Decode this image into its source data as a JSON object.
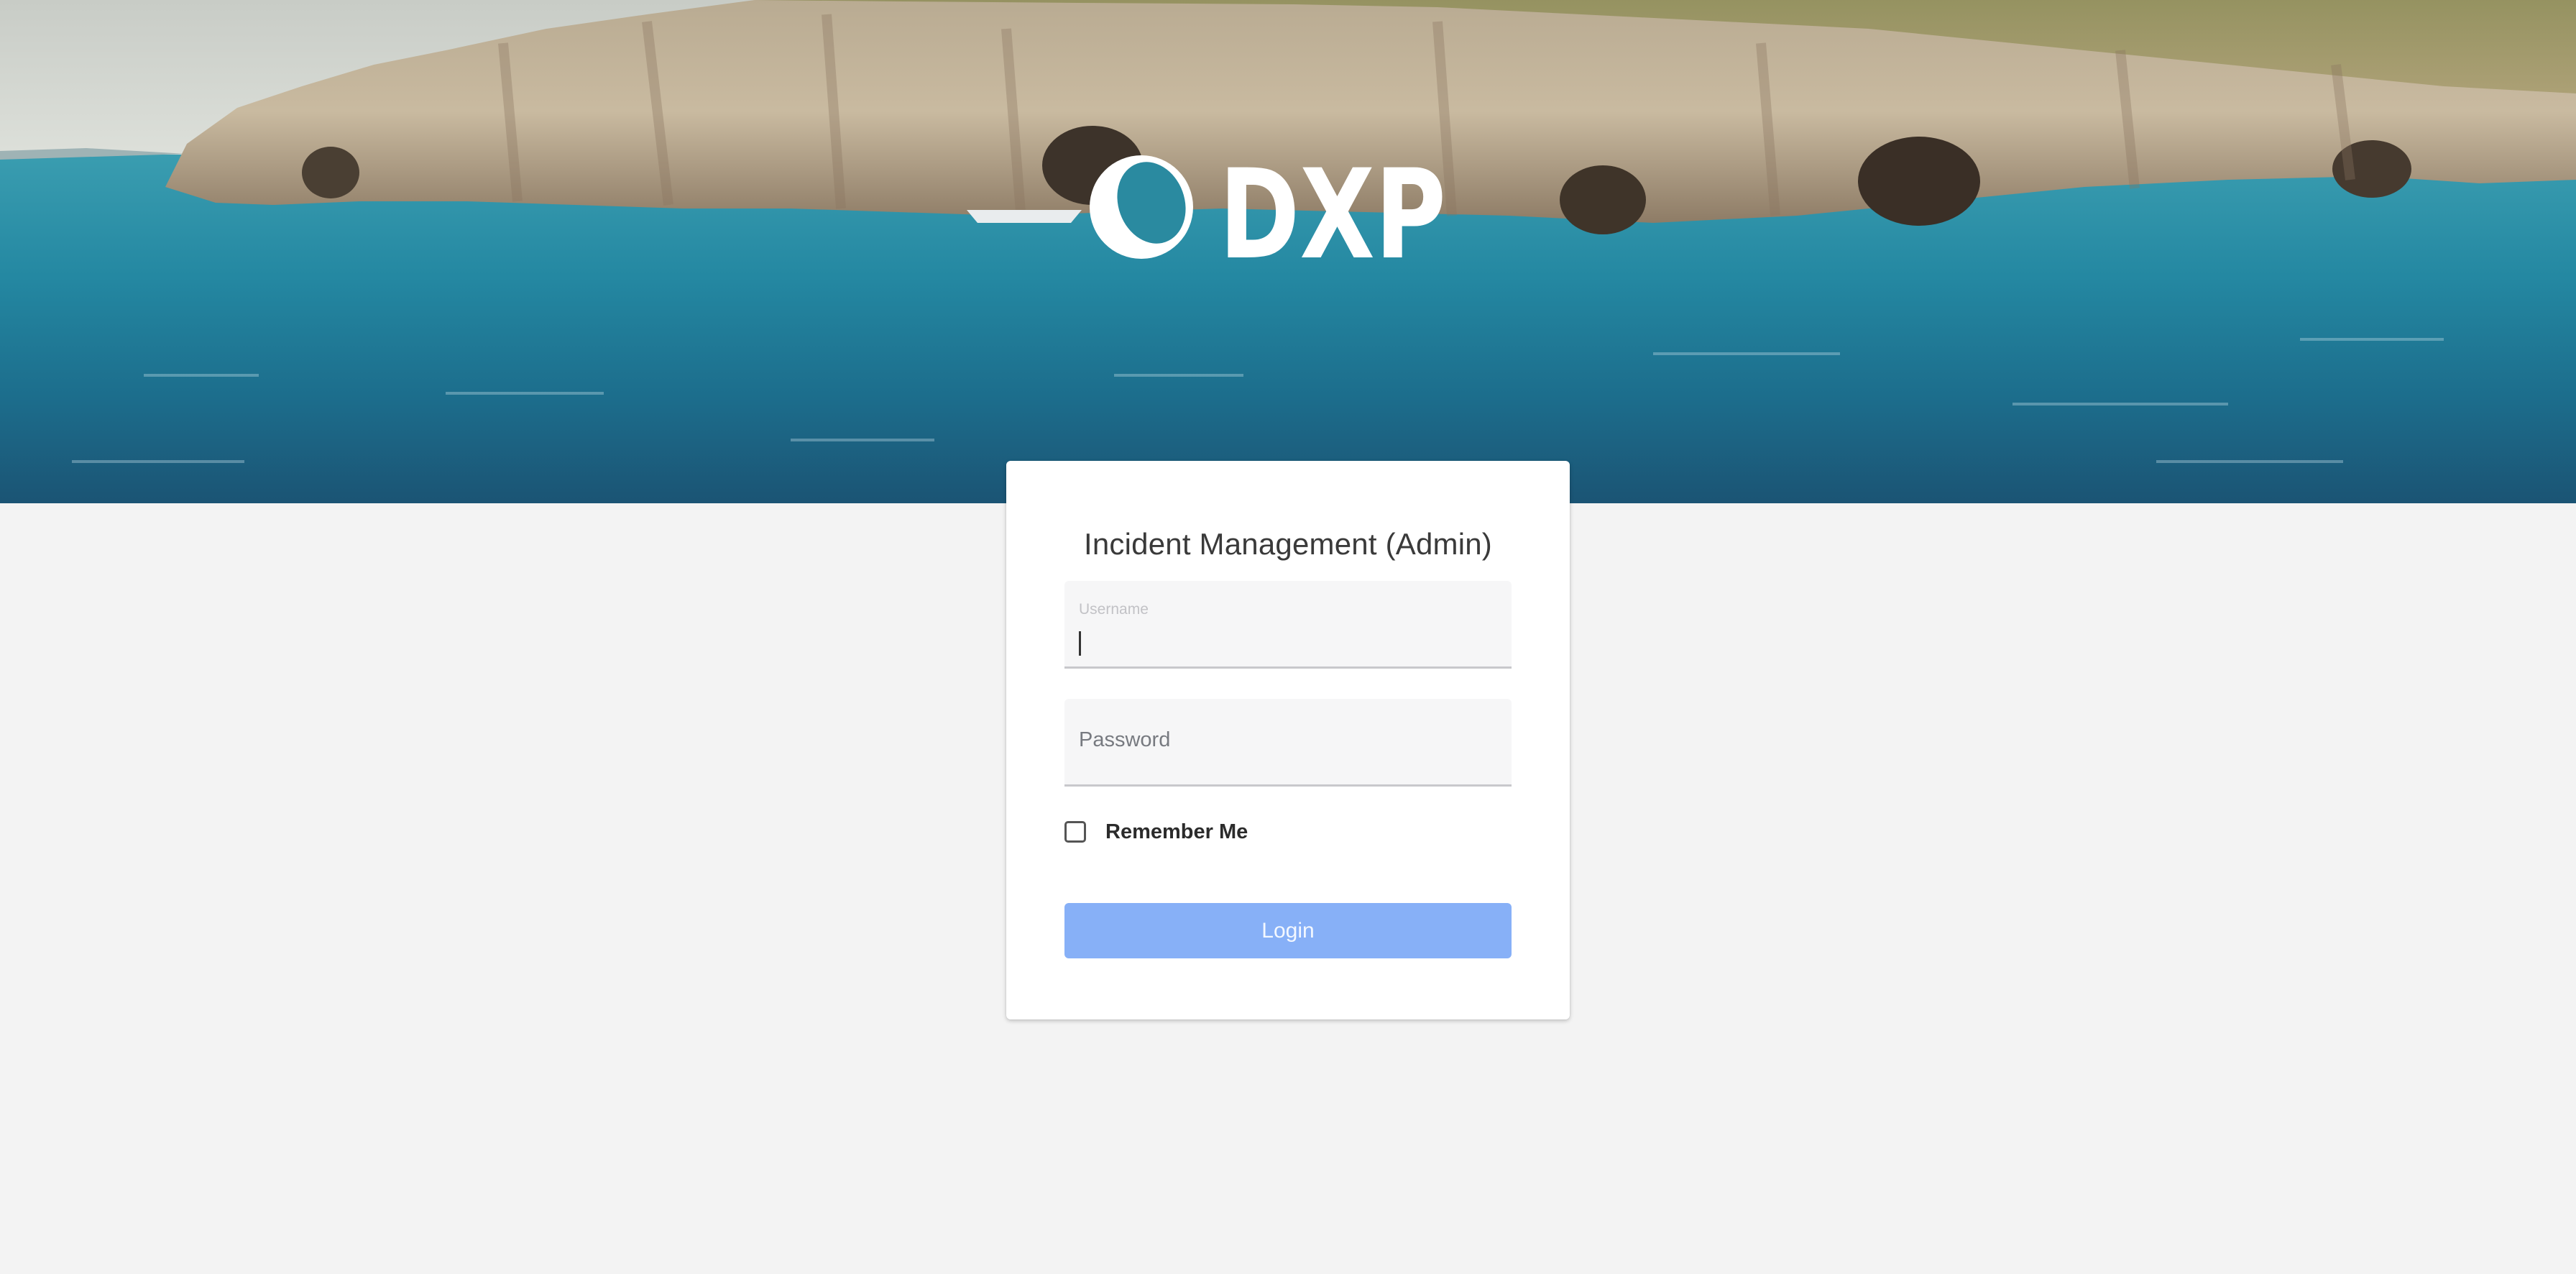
{
  "hero": {
    "logo_text": "DXP"
  },
  "login": {
    "title": "Incident Management (Admin)",
    "username": {
      "label": "Username",
      "value": ""
    },
    "password": {
      "placeholder": "Password",
      "value": ""
    },
    "remember_me_label": "Remember Me",
    "remember_me_checked": false,
    "login_button_label": "Login"
  },
  "colors": {
    "background": "#f3f3f3",
    "card": "#ffffff",
    "login_button": "#87b0f7",
    "field_background": "#f6f6f7"
  }
}
